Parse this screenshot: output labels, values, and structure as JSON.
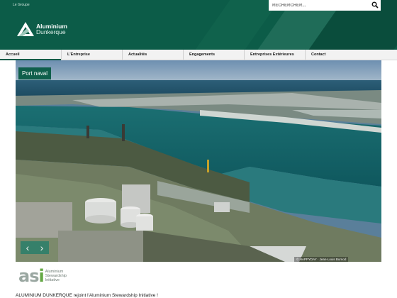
{
  "header": {
    "top_link": "Le Groupe",
    "search_placeholder": "RECHERCHER...",
    "logo_line1": "Aluminium",
    "logo_line2": "Dunkerque"
  },
  "nav": {
    "items": [
      {
        "label": "Accueil"
      },
      {
        "label": "L'Entreprise"
      },
      {
        "label": "Actualités"
      },
      {
        "label": "Engagements"
      },
      {
        "label": "Entreprises Extérieures"
      },
      {
        "label": "Contact"
      }
    ]
  },
  "slider": {
    "caption": "Port naval",
    "credit": "© HAPPYDAY · Jean-Louis Burnod",
    "prev": "‹",
    "next": "›"
  },
  "news": {
    "logo_text": "asi",
    "logo_label": "Aluminium Stewardship Initiative",
    "headline": "ALUMINIUM DUNKERQUE rejoint l'Aluminium Stewardship Initiative !"
  },
  "colors": {
    "brand": "#0c5c48",
    "accent": "#2f7f6a"
  }
}
